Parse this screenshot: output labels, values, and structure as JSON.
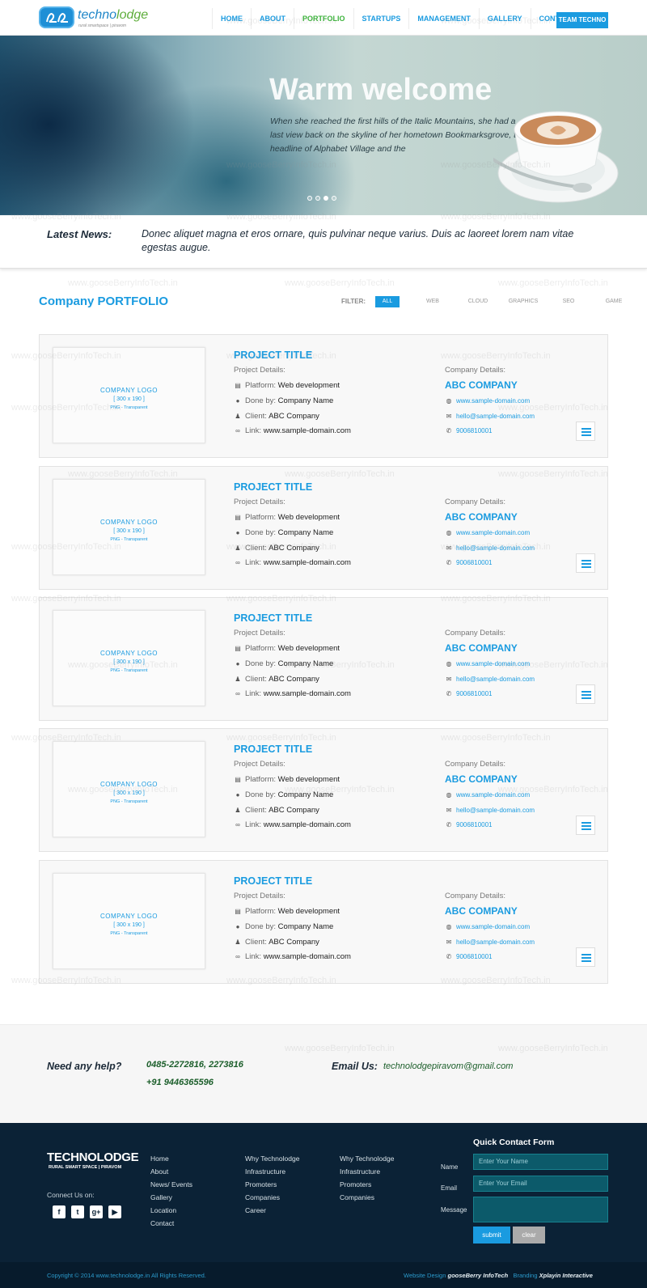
{
  "header": {
    "logo_text_a": "techno",
    "logo_text_b": "lodge",
    "logo_sub": "rural smartspace | piravom",
    "nav": [
      "HOME",
      "ABOUT",
      "PORTFOLIO",
      "STARTUPS",
      "MANAGEMENT",
      "GALLERY",
      "CONTACT"
    ],
    "active_nav": "PORTFOLIO",
    "cta": "TEAM TECHNO"
  },
  "hero": {
    "title": "Warm welcome",
    "text": "When she reached the first hills of the Italic Mountains, she had a last view back on the skyline of her hometown Bookmarksgrove, the headline of Alphabet Village and the",
    "slides": 4,
    "active_slide": 3
  },
  "news": {
    "label": "Latest News:",
    "text": "Donec aliquet magna et eros ornare, quis pulvinar neque varius. Duis ac laoreet lorem nam vitae egestas augue."
  },
  "portfolio": {
    "title": "Company PORTFOLIO",
    "filter_label": "FILTER:",
    "filters": [
      "ALL",
      "WEB",
      "CLOUD",
      "GRAPHICS",
      "SEO",
      "GAME"
    ],
    "active_filter": "ALL",
    "thumb": {
      "line1": "COMPANY   LOGO",
      "line2": "[ 300 x 190 ]",
      "line3": "PNG - Transparent"
    },
    "labels": {
      "project_details": "Project Details:",
      "platform": "Platform:",
      "done_by": "Done by:",
      "client": "Client:",
      "link": "Link:",
      "company_details": "Company Details:"
    },
    "items": [
      {
        "title": "PROJECT TITLE",
        "platform": "Web development",
        "done_by": "Company Name",
        "client": "ABC Company",
        "link": "www.sample-domain.com",
        "company": "ABC COMPANY",
        "website": "www.sample-domain.com",
        "email": "hello@sample-domain.com",
        "phone": "9006810001"
      },
      {
        "title": "PROJECT TITLE",
        "platform": "Web development",
        "done_by": "Company Name",
        "client": "ABC Company",
        "link": "www.sample-domain.com",
        "company": "ABC COMPANY",
        "website": "www.sample-domain.com",
        "email": "hello@sample-domain.com",
        "phone": "9006810001"
      },
      {
        "title": "PROJECT TITLE",
        "platform": "Web development",
        "done_by": "Company Name",
        "client": "ABC Company",
        "link": "www.sample-domain.com",
        "company": "ABC COMPANY",
        "website": "www.sample-domain.com",
        "email": "hello@sample-domain.com",
        "phone": "9006810001"
      },
      {
        "title": "PROJECT TITLE",
        "platform": "Web development",
        "done_by": "Company Name",
        "client": "ABC Company",
        "link": "www.sample-domain.com",
        "company": "ABC COMPANY",
        "website": "www.sample-domain.com",
        "email": "hello@sample-domain.com",
        "phone": "9006810001"
      },
      {
        "title": "PROJECT TITLE",
        "platform": "Web development",
        "done_by": "Company Name",
        "client": "ABC Company",
        "link": "www.sample-domain.com",
        "company": "ABC COMPANY",
        "website": "www.sample-domain.com",
        "email": "hello@sample-domain.com",
        "phone": "9006810001"
      }
    ]
  },
  "help": {
    "question": "Need any help?",
    "phone1": "0485-2272816, 2273816",
    "phone2": "+91 9446365596",
    "email_label": "Email Us:",
    "email": "technolodgepiravom@gmail.com"
  },
  "footer": {
    "logo": "TECHNOLODGE",
    "logo_sub": "RURAL SMART SPACE  |  PIRAVOM",
    "connect": "Connect Us on:",
    "col1": [
      "Home",
      "About",
      "News/ Events",
      "Gallery",
      "Location",
      "Contact"
    ],
    "col2": [
      "Why Technolodge",
      "Infrastructure",
      "Promoters",
      "Companies",
      "Career"
    ],
    "col3": [
      "Why Technolodge",
      "Infrastructure",
      "Promoters",
      "Companies"
    ],
    "form": {
      "title": "Quick Contact Form",
      "name_label": "Name",
      "name_placeholder": "Enter Your Name",
      "email_label": "Email",
      "email_placeholder": "Enter Your Email",
      "message_label": "Message",
      "submit": "submit",
      "clear": "clear"
    }
  },
  "copyright": {
    "left": "Copyright  © 2014   www.technolodge.in   All Rights Reserved.",
    "design_label": "Website Design",
    "design": "gooseBerry InfoTech",
    "branding_label": "Branding",
    "branding": "Xplayin Interactive"
  },
  "watermark": "www.gooseBerryInfoTech.in",
  "colors": {
    "accent": "#1a9be0",
    "active_nav": "#3db33c",
    "footer_bg": "#0b2236"
  }
}
